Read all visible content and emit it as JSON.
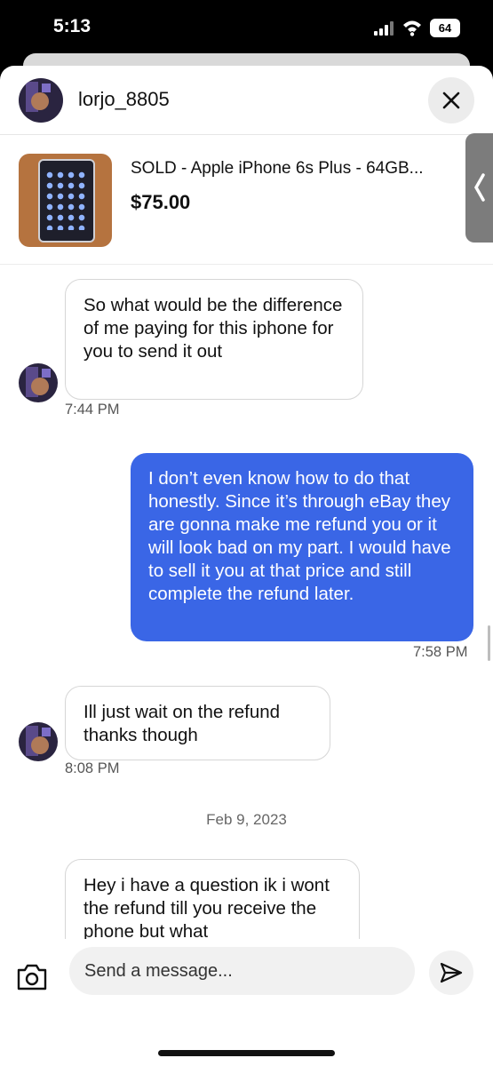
{
  "status_bar": {
    "time": "5:13",
    "battery": "64"
  },
  "header": {
    "username": "lorjo_8805"
  },
  "listing": {
    "title": "SOLD - Apple iPhone 6s Plus - 64GB...",
    "price": "$75.00"
  },
  "messages": [
    {
      "direction": "incoming",
      "text": "So what would be the difference of me paying for this iphone for you to send it out",
      "time": "7:44 PM"
    },
    {
      "direction": "outgoing",
      "text": "I don’t even know how to do that honestly.  Since it’s through eBay they are gonna make me refund you or it will look bad on my part.  I would have to sell it  you at that price and still complete the refund later.",
      "time": "7:58 PM"
    },
    {
      "direction": "incoming",
      "text": "Ill just wait on the refund thanks though",
      "time": "8:08 PM"
    },
    {
      "direction": "incoming",
      "text": "Hey i have a question ik i wont the refund till you receive the phone but what"
    }
  ],
  "date_separator": "Feb 9, 2023",
  "composer": {
    "placeholder": "Send a message..."
  },
  "colors": {
    "outgoing_bubble": "#3a66e6",
    "incoming_border": "#d6d6d6"
  },
  "icons": [
    "close-icon",
    "chevron-left-icon",
    "camera-icon",
    "send-icon",
    "wifi-icon",
    "signal-icon"
  ]
}
